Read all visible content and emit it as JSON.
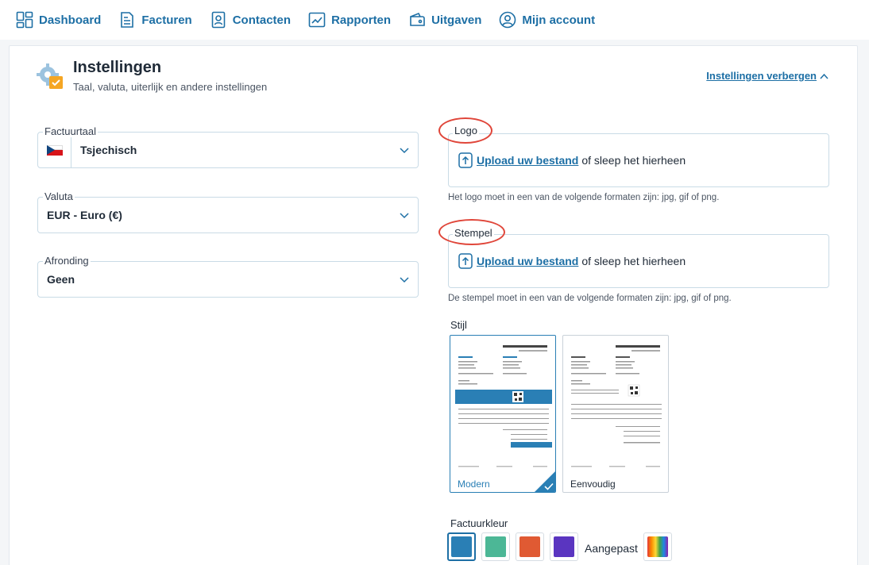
{
  "nav": {
    "items": [
      {
        "label": "Dashboard",
        "icon": "dashboard-icon"
      },
      {
        "label": "Facturen",
        "icon": "invoice-icon"
      },
      {
        "label": "Contacten",
        "icon": "contacts-icon"
      },
      {
        "label": "Rapporten",
        "icon": "reports-icon"
      },
      {
        "label": "Uitgaven",
        "icon": "wallet-icon"
      },
      {
        "label": "Mijn account",
        "icon": "user-icon"
      }
    ]
  },
  "header": {
    "title": "Instellingen",
    "subtitle": "Taal, valuta, uiterlijk en andere instellingen",
    "toggle_label": "Instellingen verbergen"
  },
  "settings": {
    "language": {
      "label": "Factuurtaal",
      "value": "Tsjechisch",
      "flag": "cz-flag-icon"
    },
    "currency": {
      "label": "Valuta",
      "value": "EUR - Euro (€)"
    },
    "rounding": {
      "label": "Afronding",
      "value": "Geen"
    }
  },
  "logo": {
    "label": "Logo",
    "upload_link": "Upload uw bestand",
    "upload_rest": "of sleep het hierheen",
    "hint": "Het logo moet in een van de volgende formaten zijn: jpg, gif of png."
  },
  "stamp": {
    "label": "Stempel",
    "upload_link": "Upload uw bestand",
    "upload_rest": "of sleep het hierheen",
    "hint": "De stempel moet in een van de volgende formaten zijn: jpg, gif of png."
  },
  "style": {
    "label": "Stijl",
    "options": [
      {
        "name": "Modern",
        "selected": true
      },
      {
        "name": "Eenvoudig",
        "selected": false
      }
    ]
  },
  "invoice_color": {
    "label": "Factuurkleur",
    "swatches": [
      "#2a7fb5",
      "#4cb796",
      "#e05a33",
      "#5a35c0"
    ],
    "selected": "#2a7fb5",
    "custom_label": "Aangepast"
  },
  "colors": {
    "accent": "#1d6fa5",
    "highlight_ring": "#e0463a"
  }
}
